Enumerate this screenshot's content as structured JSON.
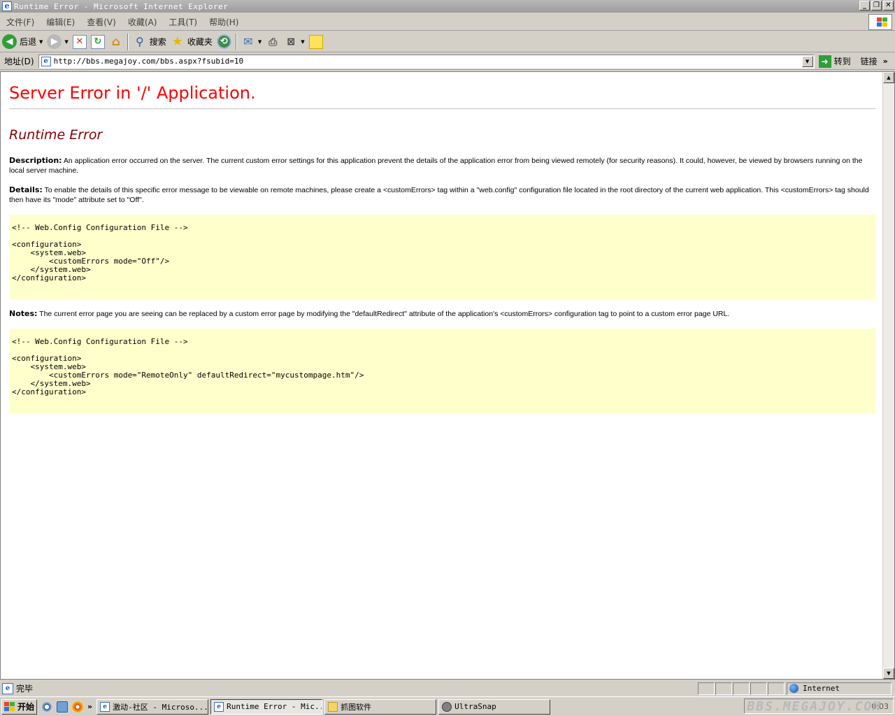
{
  "window": {
    "title": "Runtime Error - Microsoft Internet Explorer",
    "app_icon": "ie-page-icon",
    "controls": {
      "minimize": "_",
      "restore": "❐",
      "close": "✕"
    }
  },
  "menubar": {
    "items": [
      "文件(F)",
      "编辑(E)",
      "查看(V)",
      "收藏(A)",
      "工具(T)",
      "帮助(H)"
    ]
  },
  "toolbar": {
    "back_label": "后退",
    "search_label": "搜索",
    "favorites_label": "收藏夹"
  },
  "addressbar": {
    "label": "地址(D)",
    "url": "http://bbs.megajoy.com/bbs.aspx?fsubid=10",
    "go_label": "转到",
    "links_label": "链接"
  },
  "page": {
    "heading": "Server Error in '/' Application.",
    "subheading": "Runtime Error",
    "description_label": "Description:",
    "description_text": " An application error occurred on the server. The current custom error settings for this application prevent the details of the application error from being viewed remotely (for security reasons). It could, however, be viewed by browsers running on the local server machine.",
    "details_label": "Details:",
    "details_text": " To enable the details of this specific error message to be viewable on remote machines, please create a <customErrors> tag within a \"web.config\" configuration file located in the root directory of the current web application. This <customErrors> tag should then have its \"mode\" attribute set to \"Off\".",
    "code1": "<!-- Web.Config Configuration File -->\n\n<configuration>\n    <system.web>\n        <customErrors mode=\"Off\"/>\n    </system.web>\n</configuration>",
    "notes_label": "Notes:",
    "notes_text": " The current error page you are seeing can be replaced by a custom error page by modifying the \"defaultRedirect\" attribute of the application's <customErrors> configuration tag to point to a custom error page URL.",
    "code2": "<!-- Web.Config Configuration File -->\n\n<configuration>\n    <system.web>\n        <customErrors mode=\"RemoteOnly\" defaultRedirect=\"mycustompage.htm\"/>\n    </system.web>\n</configuration>"
  },
  "statusbar": {
    "text": "完毕",
    "zone": "Internet"
  },
  "taskbar": {
    "start_label": "开始",
    "tasks": [
      {
        "label": "激动-社区 - Microso..."
      },
      {
        "label": "Runtime Error - Mic..."
      },
      {
        "label": "抓图软件"
      },
      {
        "label": "UltraSnap"
      }
    ],
    "watermark": "BBS.MEGAJOY.COM",
    "clock": "0:03"
  }
}
